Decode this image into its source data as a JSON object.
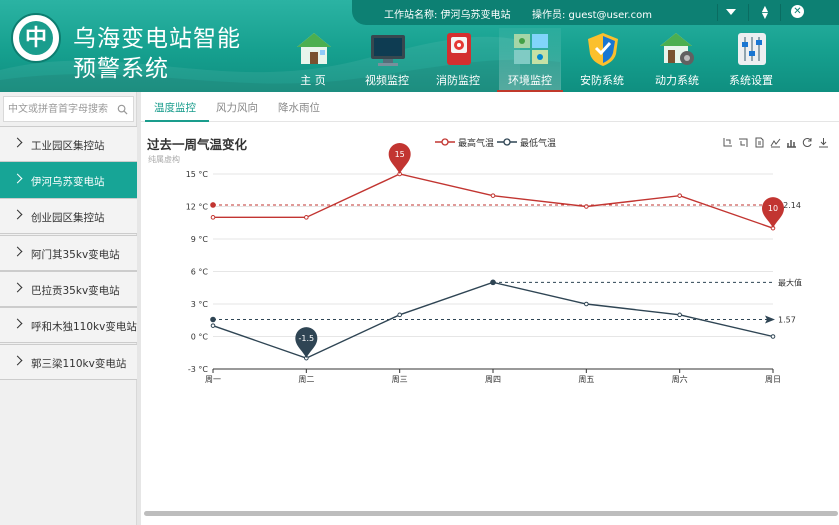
{
  "header": {
    "title_line1": "乌海变电站智能",
    "title_line2": "预警系统",
    "logo_char": "中",
    "station_label": "工作站名称: 伊河乌苏变电站",
    "operator_label": "操作员: guest@user.com",
    "accent": "#1a9d8d"
  },
  "nav": [
    {
      "label": "主 页",
      "icon": "home-icon"
    },
    {
      "label": "视频监控",
      "icon": "monitor-icon"
    },
    {
      "label": "消防监控",
      "icon": "fire-alarm-icon"
    },
    {
      "label": "环境监控",
      "icon": "environment-icon",
      "active": true
    },
    {
      "label": "安防系统",
      "icon": "shield-icon"
    },
    {
      "label": "动力系统",
      "icon": "power-house-icon"
    },
    {
      "label": "系统设置",
      "icon": "sliders-icon"
    }
  ],
  "sidebar": {
    "search_placeholder": "中文或拼音首字母搜索",
    "items": [
      {
        "label": "工业园区集控站"
      },
      {
        "label": "伊河乌苏变电站",
        "active": true
      },
      {
        "label": "创业园区集控站"
      },
      {
        "label": "阿门其35kv变电站"
      },
      {
        "label": "巴拉贡35kv变电站"
      },
      {
        "label": "呼和木独110kv变电站"
      },
      {
        "label": "郭三梁110kv变电站"
      }
    ]
  },
  "tabs": [
    {
      "label": "温度监控",
      "active": true
    },
    {
      "label": "风力风向"
    },
    {
      "label": "降水雨位"
    }
  ],
  "chart_data": {
    "type": "line",
    "title": "过去一周气温变化",
    "subtitle": "纯属虚构",
    "categories": [
      "周一",
      "周二",
      "周三",
      "周四",
      "周五",
      "周六",
      "周日"
    ],
    "ylim": [
      -3,
      15
    ],
    "yticks": [
      -3,
      0,
      3,
      6,
      9,
      12,
      15
    ],
    "y_tick_suffix": " °C",
    "grid": true,
    "legend_position": "top-center",
    "series": [
      {
        "name": "最高气温",
        "color": "#c23531",
        "values": [
          11,
          11,
          15,
          13,
          12,
          13,
          10
        ],
        "max_pin": {
          "label": "15",
          "index": 2
        },
        "min_pin": {
          "label": "10",
          "index": 6
        },
        "average_line": {
          "label": "12.14",
          "value": 12.14
        }
      },
      {
        "name": "最低气温",
        "color": "#2f4554",
        "values": [
          1,
          -2,
          2,
          5,
          3,
          2,
          0
        ],
        "min_pin": {
          "label": "-1.5",
          "index": 1
        },
        "average_line": {
          "label": "1.57",
          "value": 1.57
        },
        "max_line": {
          "label": "最大值",
          "value": 5
        }
      }
    ]
  }
}
